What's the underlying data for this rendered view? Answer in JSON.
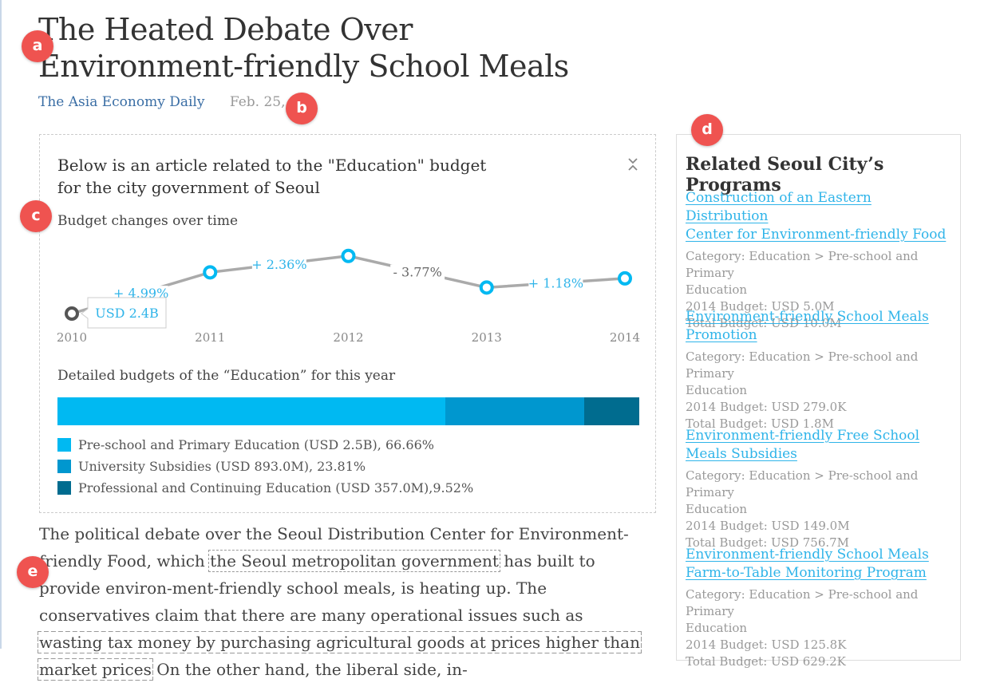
{
  "article": {
    "title_line1": "The Heated Debate Over",
    "title_line2": "Environment-friendly School Meals",
    "source": "The Asia Economy Daily",
    "date": "Feb. 25, 20"
  },
  "markers": {
    "a": "a",
    "b": "b",
    "c": "c",
    "d": "d",
    "e": "e"
  },
  "card": {
    "heading_line1": "Below is an article related to the \"Education\" budget",
    "heading_line2": "for the city government of Seoul",
    "budget_changes_title": "Budget changes over time",
    "detailed_title": "Detailed budgets of the “Education” for this year"
  },
  "chart_data": [
    {
      "type": "line",
      "title": "Budget changes over time",
      "x": [
        "2010",
        "2011",
        "2012",
        "2013",
        "2014"
      ],
      "relative_level": [
        0.0,
        0.68,
        0.95,
        0.43,
        0.58
      ],
      "tooltip": "USD 2.4B",
      "change_labels": [
        "+ 4.99%",
        "+ 2.36%",
        "- 3.77%",
        "+ 1.18%"
      ]
    },
    {
      "type": "bar",
      "title": "Detailed budgets of the “Education” for this year",
      "categories": [
        "Pre-school and Primary Education",
        "University Subsidies",
        "Professional and Continuing Education"
      ],
      "values": [
        66.66,
        23.81,
        9.52
      ],
      "legend_labels": [
        "Pre-school and Primary Education (USD 2.5B), 66.66%",
        "University Subsidies (USD 893.0M), 23.81%",
        "Professional and Continuing Education (USD 357.0M),9.52%"
      ],
      "colors": [
        "#00b9f2",
        "#0097cf",
        "#006c8f"
      ]
    }
  ],
  "sidebar": {
    "title": "Related Seoul City’s Programs",
    "programs": [
      {
        "link_line1": "Construction of an Eastern Distribution",
        "link_line2": "Center for Environment-friendly Food",
        "category_line1": "Category: Education > Pre-school and Primary",
        "category_line2": "Education",
        "budget_2014": "2014 Budget: USD 5.0M",
        "total_budget": "Total Budget: USD 10.0M"
      },
      {
        "link_line1": "Environment-friendly School Meals",
        "link_line2": "Promotion",
        "category_line1": "Category: Education > Pre-school and Primary",
        "category_line2": "Education",
        "budget_2014": "2014 Budget: USD 279.0K",
        "total_budget": "Total Budget: USD 1.8M"
      },
      {
        "link_line1": "Environment-friendly Free School",
        "link_line2": "Meals Subsidies",
        "category_line1": "Category: Education > Pre-school and Primary",
        "category_line2": "Education",
        "budget_2014": "2014 Budget: USD 149.0M",
        "total_budget": "Total Budget: USD 756.7M"
      },
      {
        "link_line1": "Environment-friendly School Meals",
        "link_line2": "Farm-to-Table Monitoring Program",
        "category_line1": "Category: Education > Pre-school and Primary",
        "category_line2": "Education",
        "budget_2014": "2014 Budget: USD 125.8K",
        "total_budget": "Total Budget: USD 629.2K"
      }
    ]
  },
  "body": {
    "p1_a": "The political debate over the Seoul Distribution Center for Environment-friendly Food, which ",
    "hl1": "the Seoul metropolitan government",
    "p1_b": " has built to provide environ-ment-friendly school meals, is heating up. The conservatives claim that there are many operational issues such as ",
    "hl2": "wasting tax money by purchasing agricultural goods at prices higher than market prices",
    "p1_c": " On the other hand, the liberal side, in-"
  }
}
